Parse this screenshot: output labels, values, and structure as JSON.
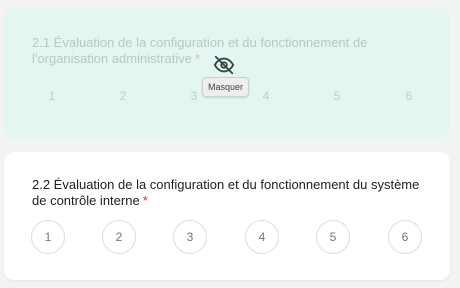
{
  "questions": [
    {
      "title": "2.1 Évaluation de la configuration et du fonctionnement de l'organisation administrative",
      "required_mark": "*",
      "state": "hidden",
      "scale": [
        "1",
        "2",
        "3",
        "4",
        "5",
        "6"
      ]
    },
    {
      "title": "2.2 Évaluation de la configuration et du fonctionnement du système de contrôle interne",
      "required_mark": "*",
      "state": "active",
      "scale": [
        "1",
        "2",
        "3",
        "4",
        "5",
        "6"
      ]
    }
  ],
  "visibility_toggle": {
    "icon": "eye-off-icon",
    "tooltip": "Masquer"
  },
  "colors": {
    "page_background": "#f1f3f4",
    "hidden_card_background": "#e3f6f1",
    "active_card_background": "#ffffff",
    "required": "#d93025"
  }
}
